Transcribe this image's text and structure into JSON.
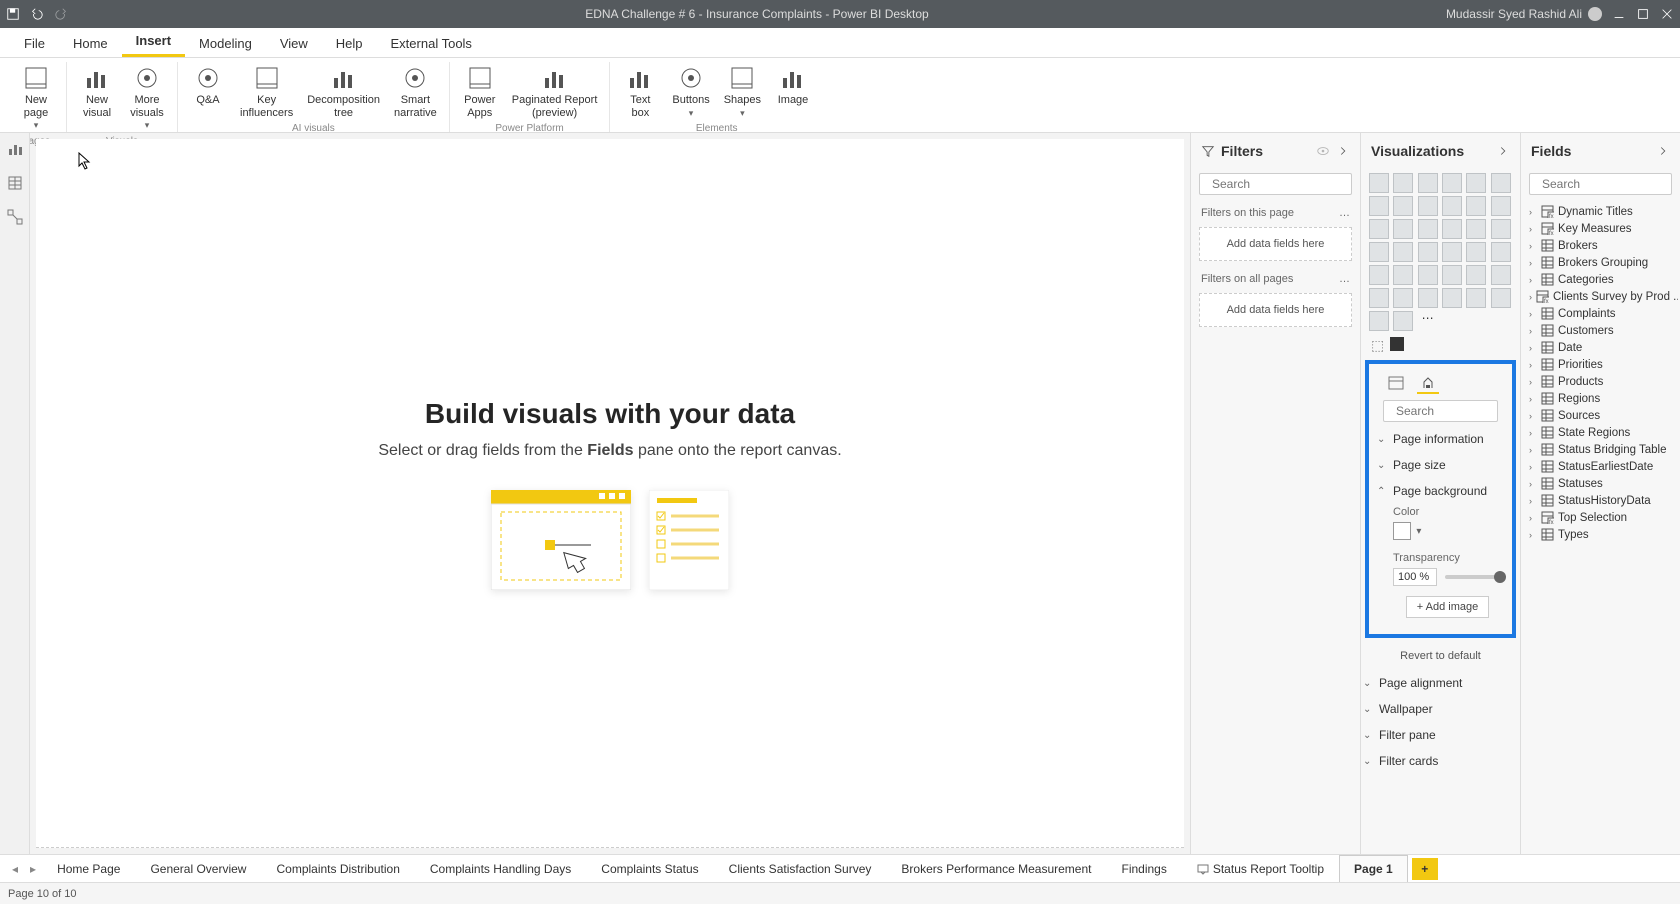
{
  "titlebar": {
    "title": "EDNA Challenge # 6 - Insurance Complaints - Power BI Desktop",
    "user": "Mudassir Syed Rashid Ali"
  },
  "menu": {
    "tabs": [
      "File",
      "Home",
      "Insert",
      "Modeling",
      "View",
      "Help",
      "External Tools"
    ],
    "active": "Insert"
  },
  "ribbon": {
    "groups": [
      {
        "name": "Pages",
        "items": [
          {
            "label": "New\npage",
            "chev": true
          }
        ]
      },
      {
        "name": "Visuals",
        "items": [
          {
            "label": "New\nvisual"
          },
          {
            "label": "More\nvisuals",
            "chev": true
          }
        ]
      },
      {
        "name": "AI visuals",
        "items": [
          {
            "label": "Q&A"
          },
          {
            "label": "Key\ninfluencers"
          },
          {
            "label": "Decomposition\ntree"
          },
          {
            "label": "Smart\nnarrative"
          }
        ]
      },
      {
        "name": "Power Platform",
        "items": [
          {
            "label": "Power\nApps"
          },
          {
            "label": "Paginated Report\n(preview)"
          }
        ]
      },
      {
        "name": "Elements",
        "items": [
          {
            "label": "Text\nbox"
          },
          {
            "label": "Buttons",
            "chev": true
          },
          {
            "label": "Shapes",
            "chev": true
          },
          {
            "label": "Image"
          }
        ]
      }
    ]
  },
  "canvas": {
    "heading": "Build visuals with your data",
    "sub_pre": "Select or drag fields from the ",
    "sub_bold": "Fields",
    "sub_post": " pane onto the report canvas."
  },
  "filters": {
    "title": "Filters",
    "search_ph": "Search",
    "page_head": "Filters on this page",
    "page_drop": "Add data fields here",
    "all_head": "Filters on all pages",
    "all_drop": "Add data fields here"
  },
  "viz": {
    "title": "Visualizations",
    "search_ph": "Search",
    "sections": {
      "page_info": "Page information",
      "page_size": "Page size",
      "page_bg": "Page background",
      "color_lbl": "Color",
      "trans_lbl": "Transparency",
      "trans_val": "100 %",
      "add_image": "+ Add image",
      "revert": "Revert to default",
      "page_align": "Page alignment",
      "wallpaper": "Wallpaper",
      "filter_pane": "Filter pane",
      "filter_cards": "Filter cards"
    }
  },
  "fields": {
    "title": "Fields",
    "search_ph": "Search",
    "items": [
      {
        "label": "Dynamic Titles",
        "kind": "calc"
      },
      {
        "label": "Key Measures",
        "kind": "calc"
      },
      {
        "label": "Brokers",
        "kind": "table"
      },
      {
        "label": "Brokers Grouping",
        "kind": "table"
      },
      {
        "label": "Categories",
        "kind": "table"
      },
      {
        "label": "Clients Survey by Prod ...",
        "kind": "calc"
      },
      {
        "label": "Complaints",
        "kind": "table"
      },
      {
        "label": "Customers",
        "kind": "table"
      },
      {
        "label": "Date",
        "kind": "table"
      },
      {
        "label": "Priorities",
        "kind": "table"
      },
      {
        "label": "Products",
        "kind": "table"
      },
      {
        "label": "Regions",
        "kind": "table"
      },
      {
        "label": "Sources",
        "kind": "table"
      },
      {
        "label": "State Regions",
        "kind": "table"
      },
      {
        "label": "Status Bridging Table",
        "kind": "table"
      },
      {
        "label": "StatusEarliestDate",
        "kind": "table"
      },
      {
        "label": "Statuses",
        "kind": "table"
      },
      {
        "label": "StatusHistoryData",
        "kind": "table"
      },
      {
        "label": "Top Selection",
        "kind": "calc"
      },
      {
        "label": "Types",
        "kind": "table"
      }
    ]
  },
  "pagetabs": {
    "tabs": [
      {
        "label": "Home Page"
      },
      {
        "label": "General Overview"
      },
      {
        "label": "Complaints Distribution"
      },
      {
        "label": "Complaints Handling Days"
      },
      {
        "label": "Complaints Status"
      },
      {
        "label": "Clients Satisfaction Survey"
      },
      {
        "label": "Brokers Performance Measurement"
      },
      {
        "label": "Findings"
      },
      {
        "label": "Status Report Tooltip",
        "tooltip": true
      },
      {
        "label": "Page 1",
        "active": true
      }
    ]
  },
  "statusbar": {
    "text": "Page 10 of 10"
  }
}
